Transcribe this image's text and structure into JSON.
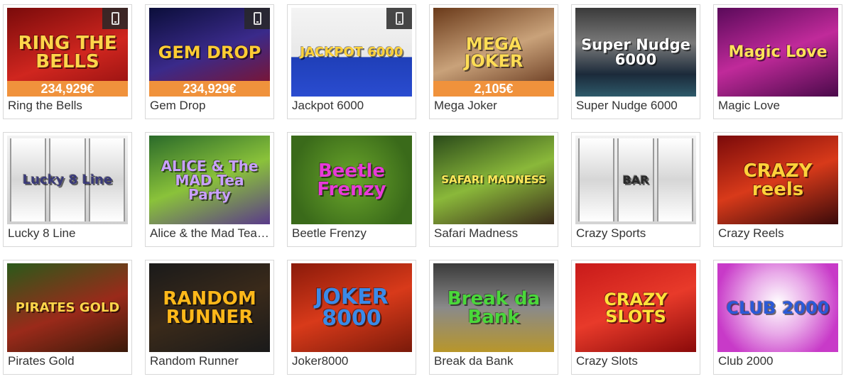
{
  "games": [
    {
      "title": "Ring the Bells",
      "logo": "RING THE BELLS",
      "jackpot": "234,929€",
      "mobile": true,
      "bg": "linear-gradient(160deg,#7a0b0b,#d0261f 55%,#8e0f0f)",
      "logo_color": "#ffd54a",
      "logo_size": 26
    },
    {
      "title": "Gem Drop",
      "logo": "GEM DROP",
      "jackpot": "234,929€",
      "mobile": true,
      "bg": "linear-gradient(160deg,#0b0e3a,#3a2a8a 50%,#8a1020)",
      "logo_color": "#ffcc33",
      "logo_size": 24
    },
    {
      "title": "Jackpot 6000",
      "logo": "JACKPOT 6000",
      "jackpot": "",
      "mobile": true,
      "bg": "linear-gradient(180deg,#f4f4f4 0%,#e8e8e8 55%,#1f3fb8 56%,#2a4cd0 100%)",
      "logo_color": "#ffd23a",
      "logo_size": 18
    },
    {
      "title": "Mega Joker",
      "logo": "MEGA JOKER",
      "jackpot": "2,105€",
      "mobile": false,
      "bg": "linear-gradient(160deg,#6a3a1a,#c9a27a 50%,#5a2a12)",
      "logo_color": "#ffdd55",
      "logo_size": 24
    },
    {
      "title": "Super Nudge 6000",
      "logo": "Super Nudge 6000",
      "jackpot": "",
      "mobile": false,
      "bg": "linear-gradient(180deg,#3a3a3a,#7a7a7a 40%,#1b2a3a 75%,#2e5a6a)",
      "logo_color": "#ffffff",
      "logo_size": 21
    },
    {
      "title": "Magic Love",
      "logo": "Magic Love",
      "jackpot": "",
      "mobile": false,
      "bg": "linear-gradient(160deg,#5a0a5a,#c02a9a 50%,#4a0a4a)",
      "logo_color": "#ffe25a",
      "logo_size": 22
    },
    {
      "title": "Lucky 8 Line",
      "logo": "Lucky 8 Line",
      "jackpot": "",
      "mobile": false,
      "bg": "linear-gradient(180deg,#f2f2f2,#cfcfcf)",
      "logo_color": "#3a3a7a",
      "logo_size": 18,
      "reels": true
    },
    {
      "title": "Alice & the Mad Tea Party",
      "logo": "ALICE & The MAD Tea Party",
      "jackpot": "",
      "mobile": false,
      "bg": "linear-gradient(160deg,#2a6a2a,#8ac23a 50%,#5a3a8a)",
      "logo_color": "#c9a0ff",
      "logo_size": 20
    },
    {
      "title": "Beetle Frenzy",
      "logo": "Beetle Frenzy",
      "jackpot": "",
      "mobile": false,
      "bg": "radial-gradient(circle at 50% 50%,#6aa62a,#3a6a1a 80%)",
      "logo_color": "#e83ad8",
      "logo_size": 26
    },
    {
      "title": "Safari Madness",
      "logo": "SAFARI MADNESS",
      "jackpot": "",
      "mobile": false,
      "bg": "linear-gradient(160deg,#2a4a1a,#8ab83a 50%,#3a2a1a)",
      "logo_color": "#ffe85a",
      "logo_size": 15
    },
    {
      "title": "Crazy Sports",
      "logo": "BAR",
      "jackpot": "",
      "mobile": false,
      "bg": "linear-gradient(180deg,#f2f2f2,#d4d4d4)",
      "logo_color": "#2a2a2a",
      "logo_size": 16,
      "reels": true
    },
    {
      "title": "Crazy Reels",
      "logo": "CRAZY reels",
      "jackpot": "",
      "mobile": false,
      "bg": "linear-gradient(160deg,#7a0a0a,#d83a1a 50%,#3a0a0a)",
      "logo_color": "#ffd23a",
      "logo_size": 26
    },
    {
      "title": "Pirates Gold",
      "logo": "PIRATES GOLD",
      "jackpot": "",
      "mobile": false,
      "bg": "linear-gradient(160deg,#2a5a1a,#9a2a1a 55%,#3a1a0a)",
      "logo_color": "#ffd54a",
      "logo_size": 18
    },
    {
      "title": "Random Runner",
      "logo": "RANDOM RUNNER",
      "jackpot": "",
      "mobile": false,
      "bg": "linear-gradient(160deg,#1a1a1a,#3a2a1a 50%,#1a1a1a)",
      "logo_color": "#ffb81a",
      "logo_size": 26
    },
    {
      "title": "Joker8000",
      "logo": "JOKER 8000",
      "jackpot": "",
      "mobile": false,
      "bg": "linear-gradient(160deg,#8a1a0a,#d83a1a 50%,#7a1a0a)",
      "logo_color": "#3a8ae8",
      "logo_size": 30
    },
    {
      "title": "Break da Bank",
      "logo": "Break da Bank",
      "jackpot": "",
      "mobile": false,
      "bg": "linear-gradient(180deg,#3a3a3a,#8a8a8a 50%,#b8962a)",
      "logo_color": "#4ad83a",
      "logo_size": 26
    },
    {
      "title": "Crazy Slots",
      "logo": "CRAZY SLOTS",
      "jackpot": "",
      "mobile": false,
      "bg": "linear-gradient(160deg,#c81a1a,#e83a2a 50%,#8a0a0a)",
      "logo_color": "#ffe23a",
      "logo_size": 24
    },
    {
      "title": "Club 2000",
      "logo": "CLUB 2000",
      "jackpot": "",
      "mobile": false,
      "bg": "radial-gradient(circle at 50% 45%,#ffffff,#e8a8e8 40%,#c83ac8 80%)",
      "logo_color": "#2a5ad8",
      "logo_size": 24
    }
  ]
}
